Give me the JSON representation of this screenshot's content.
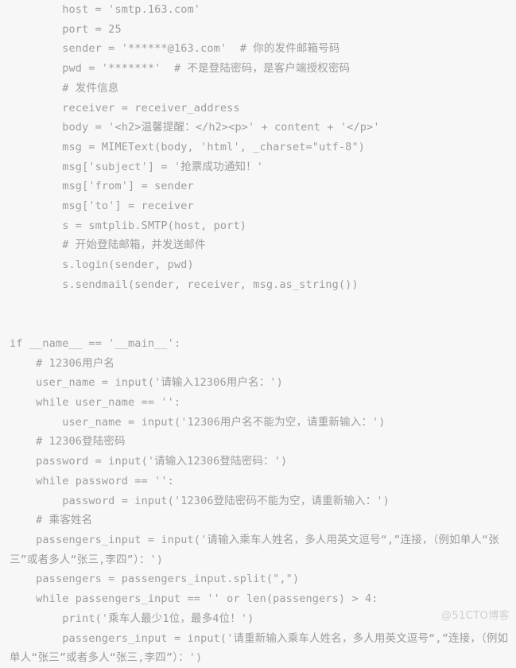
{
  "page": {
    "kind": "code-screenshot",
    "language": "Python",
    "background_color": "#f7f7f7",
    "text_color": "#9d9d9d",
    "watermark_color": "#cfcfcf"
  },
  "watermark": {
    "text": "@51CTO博客"
  },
  "code": {
    "lines": [
      "        host = 'smtp.163.com'",
      "        port = 25",
      "        sender = '******@163.com'  # 你的发件邮箱号码",
      "        pwd = '*******'  # 不是登陆密码，是客户端授权密码",
      "        # 发件信息",
      "        receiver = receiver_address",
      "        body = '<h2>温馨提醒：</h2><p>' + content + '</p>'",
      "        msg = MIMEText(body, 'html', _charset=\"utf-8\")",
      "        msg['subject'] = '抢票成功通知！'",
      "        msg['from'] = sender",
      "        msg['to'] = receiver",
      "        s = smtplib.SMTP(host, port)",
      "        # 开始登陆邮箱，并发送邮件",
      "        s.login(sender, pwd)",
      "        s.sendmail(sender, receiver, msg.as_string())",
      "",
      "",
      "if __name__ == '__main__':",
      "    # 12306用户名",
      "    user_name = input('请输入12306用户名：')",
      "    while user_name == '':",
      "        user_name = input('12306用户名不能为空，请重新输入：')",
      "    # 12306登陆密码",
      "    password = input('请输入12306登陆密码：')",
      "    while password == '':",
      "        password = input('12306登陆密码不能为空，请重新输入：')",
      "    # 乘客姓名",
      "    passengers_input = input('请输入乘车人姓名，多人用英文逗号“,”连接，（例如单人“张三”或者多人“张三,李四”）：')",
      "    passengers = passengers_input.split(\",\")",
      "    while passengers_input == '' or len(passengers) > 4:",
      "        print('乘车人最少1位，最多4位！')",
      "        passengers_input = input('请重新输入乘车人姓名，多人用英文逗号“,”连接，（例如单人“张三”或者多人“张三,李四”）：')"
    ]
  }
}
